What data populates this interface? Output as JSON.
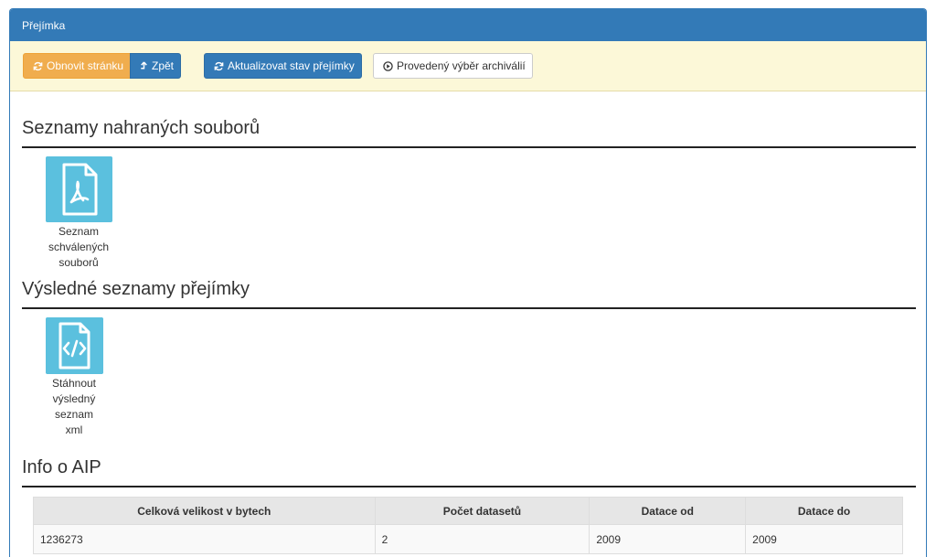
{
  "panel": {
    "title": "Přejímka"
  },
  "toolbar": {
    "refresh_label": "Obnovit stránku",
    "back_label": "Zpět",
    "update_label": "Aktualizovat stav přejímky",
    "archive_label": "Provedený výběr archiválií"
  },
  "sections": {
    "uploaded_title": "Seznamy nahraných souborů",
    "results_title": "Výsledné seznamy přejímky",
    "info_title": "Info o AIP"
  },
  "files": {
    "approved_pdf": {
      "line1": "Seznam",
      "line2": "schválených",
      "line3": "souborů",
      "icon": "pdf-file-icon"
    },
    "result_xml": {
      "line1": "Stáhnout",
      "line2": "výsledný",
      "line3": "seznam",
      "line4": "xml",
      "icon": "code-file-icon"
    }
  },
  "info_table": {
    "headers": [
      "Celková velikost v bytech",
      "Počet datasetů",
      "Datace od",
      "Datace do"
    ],
    "rows": [
      [
        "1236273",
        "2",
        "2009",
        "2009"
      ]
    ]
  },
  "colors": {
    "primary": "#337ab7",
    "warning": "#f0ad4e",
    "toolbar_bg": "#fcf8d8",
    "tile": "#5bc0de"
  }
}
